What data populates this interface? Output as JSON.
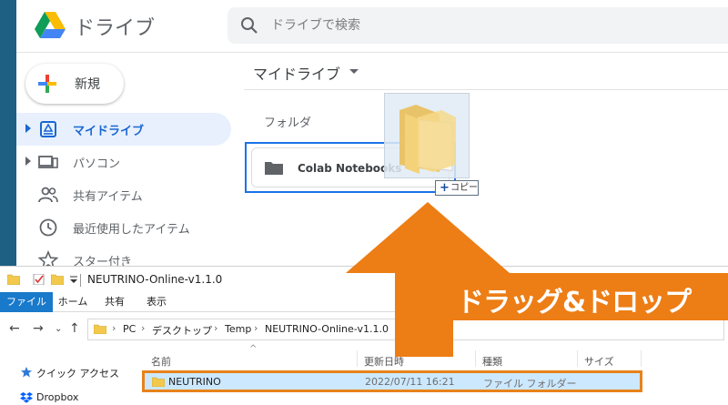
{
  "drive": {
    "app_title": "ドライブ",
    "search": {
      "placeholder": "ドライブで検索"
    },
    "new_button": "新規",
    "nav": [
      {
        "label": "マイドライブ",
        "icon": "my-drive-icon",
        "active": true
      },
      {
        "label": "パソコン",
        "icon": "computers-icon"
      },
      {
        "label": "共有アイテム",
        "icon": "shared-icon"
      },
      {
        "label": "最近使用したアイテム",
        "icon": "clock-icon"
      },
      {
        "label": "スター付き",
        "icon": "star-icon"
      }
    ],
    "breadcrumb": "マイドライブ",
    "section_label": "フォルダ",
    "folder_card": {
      "label": "Colab Notebooks",
      "icon": "folder-icon"
    },
    "drag_badge": {
      "plus": "+",
      "label": "コピー"
    }
  },
  "explorer": {
    "window_title": "NEUTRINO-Online-v1.1.0",
    "ribbon_tabs": [
      "ファイル",
      "ホーム",
      "共有",
      "表示"
    ],
    "address": {
      "segments": [
        "PC",
        "デスクトップ",
        "Temp",
        "NEUTRINO-Online-v1.1.0"
      ]
    },
    "tree": [
      {
        "label": "クイック アクセス",
        "icon": "star-icon"
      },
      {
        "label": "Dropbox",
        "icon": "dropbox-icon"
      }
    ],
    "columns": [
      "名前",
      "更新日時",
      "種類",
      "サイズ"
    ],
    "rows": [
      {
        "name": "NEUTRINO",
        "modified": "2022/07/11 16:21",
        "type": "ファイル フォルダー",
        "size": ""
      }
    ]
  },
  "caption": "ドラッグ&ドロップ",
  "colors": {
    "accent_orange": "#ed7d15",
    "drive_blue": "#1a73e8",
    "selection_blue": "#cce8ff",
    "ribbon_file_blue": "#1979ca"
  }
}
